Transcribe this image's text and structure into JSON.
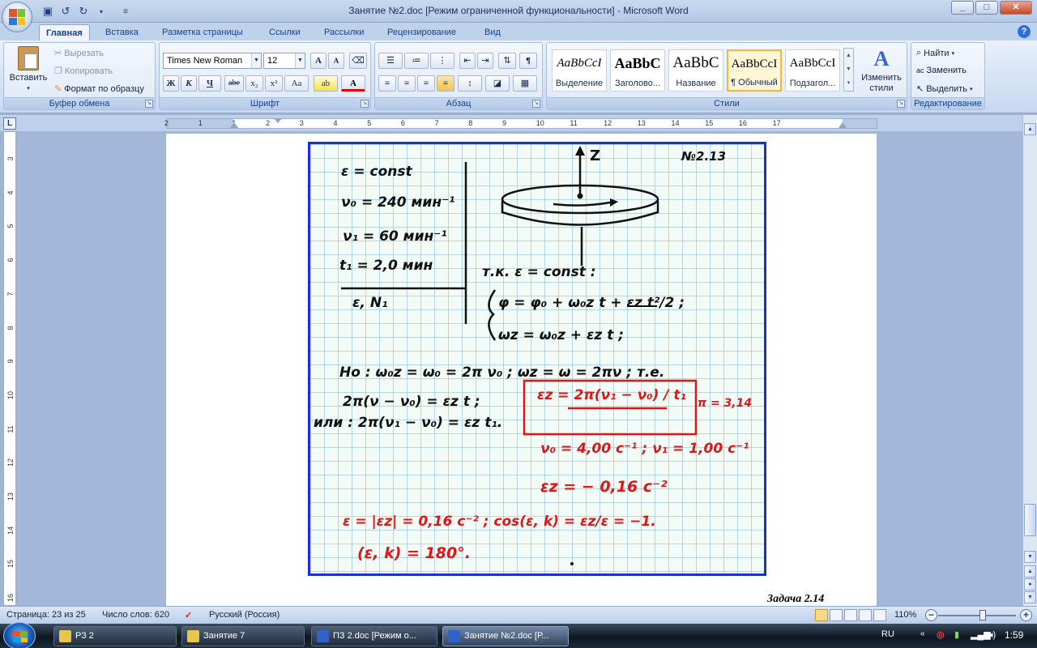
{
  "window": {
    "title": "Занятие №2.doc [Режим ограниченной функциональности] - Microsoft Word"
  },
  "tabs": [
    "Главная",
    "Вставка",
    "Разметка страницы",
    "Ссылки",
    "Рассылки",
    "Рецензирование",
    "Вид"
  ],
  "clipboard": {
    "group_label": "Буфер обмена",
    "paste": "Вставить",
    "cut": "Вырезать",
    "copy": "Копировать",
    "format_painter": "Формат по образцу"
  },
  "font": {
    "group_label": "Шрифт",
    "name": "Times New Roman",
    "size": "12",
    "bold": "Ж",
    "italic": "К",
    "underline": "Ч",
    "strike": "abe",
    "subscript": "x₂",
    "superscript": "x²",
    "case": "Aa",
    "grow": "A",
    "shrink": "A"
  },
  "paragraph": {
    "group_label": "Абзац",
    "pilcrow": "¶"
  },
  "styles": {
    "group_label": "Стили",
    "items": [
      {
        "sample": "AaBbCcI",
        "name": "Выделение"
      },
      {
        "sample": "AaBbC",
        "name": "Заголово..."
      },
      {
        "sample": "AaBbC",
        "name": "Название"
      },
      {
        "sample": "AaBbCcI",
        "name": "¶ Обычный"
      },
      {
        "sample": "AaBbCcI",
        "name": "Подзагол..."
      }
    ],
    "change_styles": "Изменить стили"
  },
  "editing": {
    "group_label": "Редактирование",
    "find": "Найти",
    "replace": "Заменить",
    "select": "Выделить"
  },
  "ruler": {
    "h_ticks": [
      "2",
      "1",
      "1",
      "2",
      "3",
      "4",
      "5",
      "6",
      "7",
      "8",
      "9",
      "10",
      "11",
      "12",
      "13",
      "14",
      "15",
      "16",
      "17"
    ],
    "v_ticks": [
      "3",
      "4",
      "5",
      "6",
      "7",
      "8",
      "9",
      "10",
      "11",
      "12",
      "13",
      "14",
      "15",
      "16"
    ]
  },
  "document": {
    "figure": {
      "problem_no": "№2.13",
      "axis_label": "Z",
      "given": [
        "ε = const",
        "ν₀ = 240 мин⁻¹",
        "ν₁ = 60 мин⁻¹",
        "t₁ = 2,0 мин"
      ],
      "find": "ε, N₁",
      "solution_black": [
        "т.к. ε = const :",
        "φ = φ₀ + ω₀z t + εz t²/2 ;",
        "ωz = ω₀z + εz t ;",
        "Но : ω₀z = ω₀ = 2π ν₀ ;  ωz = ω = 2πν ; т.е.",
        "2π(ν − ν₀) = εz t ;",
        "или : 2π(ν₁ − ν₀) = εz t₁."
      ],
      "solution_red": [
        "εz = 2π(ν₁ − ν₀) / t₁",
        "π = 3,14",
        "ν₀ = 4,00 с⁻¹ ;  ν₁ = 1,00 с⁻¹",
        "εz = − 0,16 с⁻²",
        "ε = |εz| = 0,16 с⁻² ;  cos(ε, k) = εz/ε = −1.",
        "(ε, k) = 180°."
      ]
    },
    "caption": "Задача 2.14"
  },
  "status": {
    "page": "Страница: 23 из 25",
    "words": "Число слов: 620",
    "language": "Русский (Россия)",
    "zoom": "110%",
    "zoom_level": 0.58
  },
  "taskbar": {
    "items": [
      {
        "label": "РЗ 2",
        "color": "#e8c64a"
      },
      {
        "label": "Занятие 7",
        "color": "#e8c64a"
      },
      {
        "label": "ПЗ 2.doc [Режим о...",
        "color": "#2f63c8"
      },
      {
        "label": "Занятие №2.doc [Р...",
        "color": "#2f63c8"
      }
    ],
    "lang": "RU",
    "clock": "1:59"
  }
}
